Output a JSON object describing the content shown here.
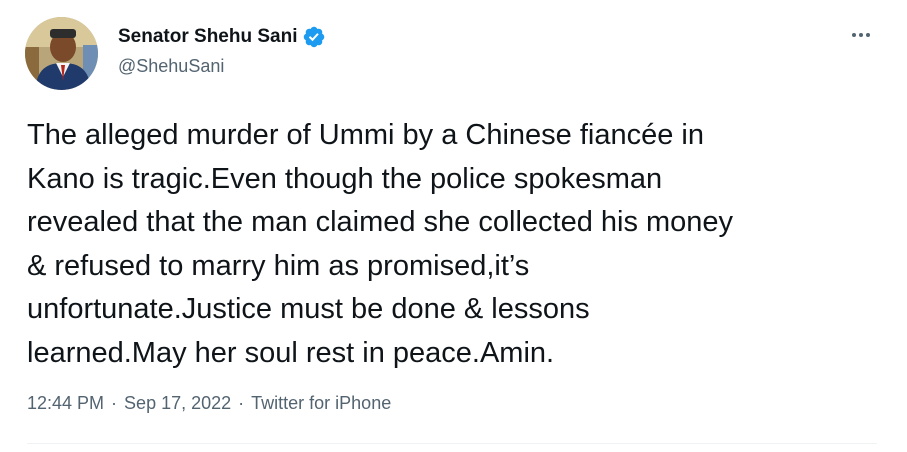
{
  "author": {
    "name": "Senator Shehu Sani",
    "handle": "@ShehuSani",
    "verified": true,
    "verified_color": "#1d9bf0"
  },
  "more_menu": {
    "icon": "more-horizontal-icon"
  },
  "tweet": {
    "text": "The alleged murder of Ummi by a Chinese fiancée in\nKano is tragic.Even though the police spokesman\nrevealed that the man claimed she collected his money\n& refused to marry him as promised,it’s\nunfortunate.Justice must be done & lessons\nlearned.May her soul rest in peace.Amin."
  },
  "meta": {
    "time": "12:44 PM",
    "separator": "·",
    "date": "Sep 17, 2022",
    "source": "Twitter for iPhone"
  },
  "colors": {
    "text_primary": "#0f1419",
    "text_secondary": "#536471",
    "divider": "#eff3f4"
  }
}
